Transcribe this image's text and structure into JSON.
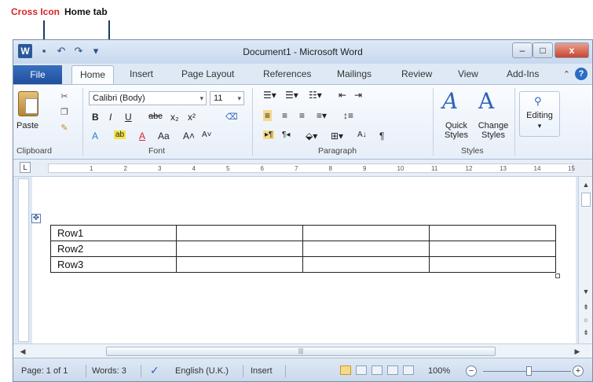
{
  "annotations": {
    "cross_icon": "Cross Icon",
    "home_tab": "Home tab"
  },
  "window": {
    "title": "Document1 - Microsoft Word",
    "logo": "W"
  },
  "tabs": {
    "file": "File",
    "home": "Home",
    "insert": "Insert",
    "page_layout": "Page Layout",
    "references": "References",
    "mailings": "Mailings",
    "review": "Review",
    "view": "View",
    "add_ins": "Add-Ins"
  },
  "ribbon": {
    "clipboard": {
      "paste": "Paste",
      "label": "Clipboard"
    },
    "font": {
      "name": "Calibri (Body)",
      "size": "11",
      "label": "Font"
    },
    "paragraph": {
      "label": "Paragraph"
    },
    "styles": {
      "quick": "Quick Styles",
      "change": "Change Styles",
      "label": "Styles"
    },
    "editing": {
      "label": "Editing"
    }
  },
  "ruler": {
    "numbers": [
      "1",
      "2",
      "3",
      "4",
      "5",
      "6",
      "7",
      "8",
      "9",
      "10",
      "11",
      "12",
      "13",
      "14",
      "15"
    ]
  },
  "table": {
    "rows": [
      [
        "Row1",
        "",
        "",
        ""
      ],
      [
        "Row2",
        "",
        "",
        ""
      ],
      [
        "Row3",
        "",
        "",
        ""
      ]
    ]
  },
  "status": {
    "page": "Page: 1 of 1",
    "words": "Words: 3",
    "language": "English (U.K.)",
    "mode": "Insert",
    "zoom": "100%"
  },
  "icons": [
    "move-handle-icon",
    "undo-icon",
    "redo-icon",
    "save-icon",
    "help-icon",
    "find-icon"
  ]
}
